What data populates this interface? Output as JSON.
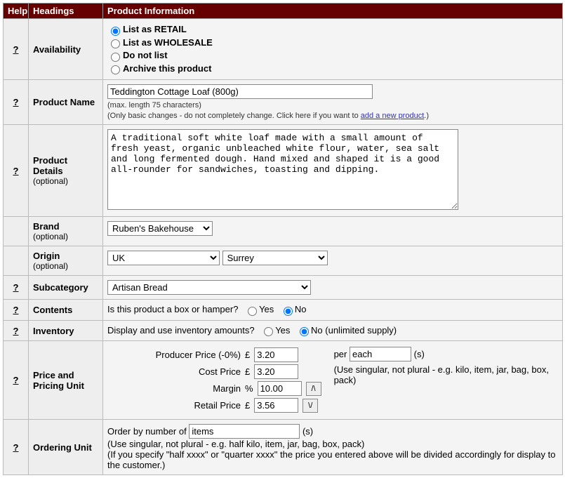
{
  "header": {
    "help": "Help",
    "headings": "Headings",
    "product_info": "Product Information"
  },
  "help_marker": "?",
  "availability": {
    "heading": "Availability",
    "options": {
      "retail": "List as RETAIL",
      "wholesale": "List as WHOLESALE",
      "donotlist": "Do not list",
      "archive": "Archive this product"
    },
    "selected": "retail"
  },
  "product_name": {
    "heading": "Product Name",
    "value": "Teddington Cottage Loaf (800g)",
    "note_maxlen": "(max. length 75 characters)",
    "note_basic_prefix": "(Only basic changes - do not completely change. Click here if you want to ",
    "note_link": "add a new product",
    "note_basic_suffix": ".)"
  },
  "product_details": {
    "heading": "Product Details",
    "optional": "(optional)",
    "value": "A traditional soft white loaf made with a small amount of fresh yeast, organic unbleached white flour, water, sea salt and long fermented dough. Hand mixed and shaped it is a good all-rounder for sandwiches, toasting and dipping."
  },
  "brand": {
    "heading": "Brand",
    "optional": "(optional)",
    "value": "Ruben's Bakehouse"
  },
  "origin": {
    "heading": "Origin",
    "optional": "(optional)",
    "country": "UK",
    "region": "Surrey"
  },
  "subcategory": {
    "heading": "Subcategory",
    "value": "Artisan Bread"
  },
  "contents": {
    "heading": "Contents",
    "question": "Is this product a box or hamper?",
    "yes": "Yes",
    "no": "No"
  },
  "inventory": {
    "heading": "Inventory",
    "question": "Display and use inventory amounts?",
    "yes": "Yes",
    "no": "No (unlimited supply)"
  },
  "pricing": {
    "heading": "Price and Pricing Unit",
    "producer_label": "Producer Price (-0%)",
    "cost_label": "Cost Price",
    "margin_label": "Margin",
    "retail_label": "Retail Price",
    "currency": "£",
    "percent": "%",
    "producer_price": "3.20",
    "cost_price": "3.20",
    "margin": "10.00",
    "retail_price": "3.56",
    "per_prefix": "per",
    "per_unit": "each",
    "per_suffix": "(s)",
    "unit_hint": "(Use singular, not plural - e.g. kilo, item, jar, bag, box, pack)",
    "arrow_up": "/\\",
    "arrow_down": "\\/"
  },
  "ordering": {
    "heading": "Ordering Unit",
    "prefix": "Order by number of",
    "unit": "items",
    "suffix": "(s)",
    "hint1": "(Use singular, not plural - e.g. half kilo, item, jar, bag, box, pack)",
    "hint2": "(If you specify \"half xxxx\" or \"quarter xxxx\" the price you entered above will be divided accordingly for display to the customer.)"
  }
}
